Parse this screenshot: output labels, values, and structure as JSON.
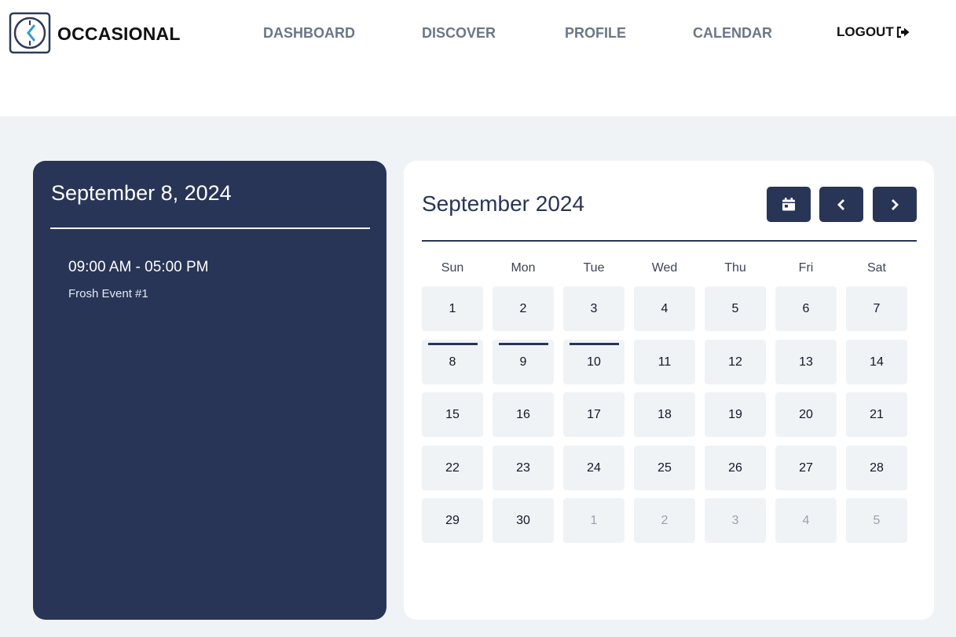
{
  "header": {
    "brand": "OCCASIONAL",
    "nav": [
      "DASHBOARD",
      "DISCOVER",
      "PROFILE",
      "CALENDAR"
    ],
    "logout_label": "LOGOUT"
  },
  "day_panel": {
    "title": "September 8, 2024",
    "events": [
      {
        "time": "09:00 AM - 05:00 PM",
        "name": "Frosh Event #1"
      }
    ]
  },
  "calendar": {
    "title": "September 2024",
    "weekdays": [
      "Sun",
      "Mon",
      "Tue",
      "Wed",
      "Thu",
      "Fri",
      "Sat"
    ],
    "days": [
      {
        "label": "1"
      },
      {
        "label": "2"
      },
      {
        "label": "3"
      },
      {
        "label": "4"
      },
      {
        "label": "5"
      },
      {
        "label": "6"
      },
      {
        "label": "7"
      },
      {
        "label": "8",
        "has_event": true
      },
      {
        "label": "9",
        "has_event": true
      },
      {
        "label": "10",
        "has_event": true
      },
      {
        "label": "11"
      },
      {
        "label": "12"
      },
      {
        "label": "13"
      },
      {
        "label": "14"
      },
      {
        "label": "15"
      },
      {
        "label": "16"
      },
      {
        "label": "17"
      },
      {
        "label": "18"
      },
      {
        "label": "19"
      },
      {
        "label": "20"
      },
      {
        "label": "21"
      },
      {
        "label": "22"
      },
      {
        "label": "23"
      },
      {
        "label": "24"
      },
      {
        "label": "25"
      },
      {
        "label": "26"
      },
      {
        "label": "27"
      },
      {
        "label": "28"
      },
      {
        "label": "29"
      },
      {
        "label": "30"
      },
      {
        "label": "1",
        "outside": true
      },
      {
        "label": "2",
        "outside": true
      },
      {
        "label": "3",
        "outside": true
      },
      {
        "label": "4",
        "outside": true
      },
      {
        "label": "5",
        "outside": true
      }
    ]
  },
  "colors": {
    "primary": "#293556",
    "background": "#f0f3f6",
    "nav_text": "#6b7686"
  }
}
